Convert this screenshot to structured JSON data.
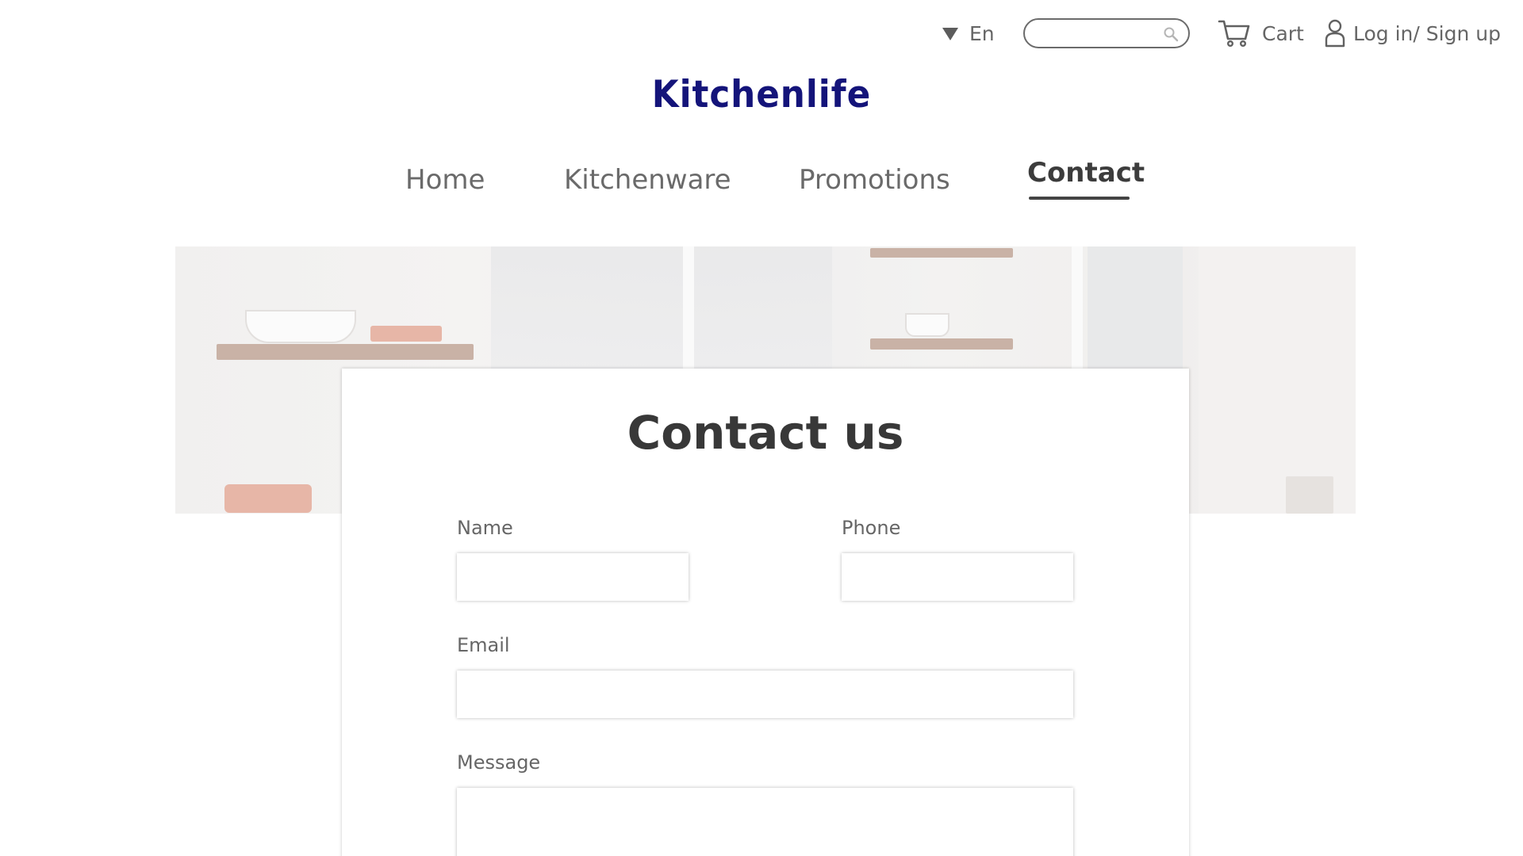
{
  "header": {
    "language": "En",
    "search_placeholder": "",
    "cart_label": "Cart",
    "login_label": "Log in/ Sign up"
  },
  "brand": {
    "logo_text": "Kitchenlife",
    "logo_color": "#14147a"
  },
  "nav": {
    "items": [
      {
        "label": "Home",
        "active": false
      },
      {
        "label": "Kitchenware",
        "active": false
      },
      {
        "label": "Promotions",
        "active": false
      },
      {
        "label": "Contact",
        "active": true
      }
    ]
  },
  "contact_form": {
    "title": "Contact us",
    "fields": {
      "name": {
        "label": "Name",
        "value": ""
      },
      "phone": {
        "label": "Phone",
        "value": ""
      },
      "email": {
        "label": "Email",
        "value": ""
      },
      "message": {
        "label": "Message",
        "value": ""
      }
    }
  },
  "icons": [
    "dropdown-triangle-icon",
    "search-icon",
    "cart-icon",
    "user-icon"
  ]
}
